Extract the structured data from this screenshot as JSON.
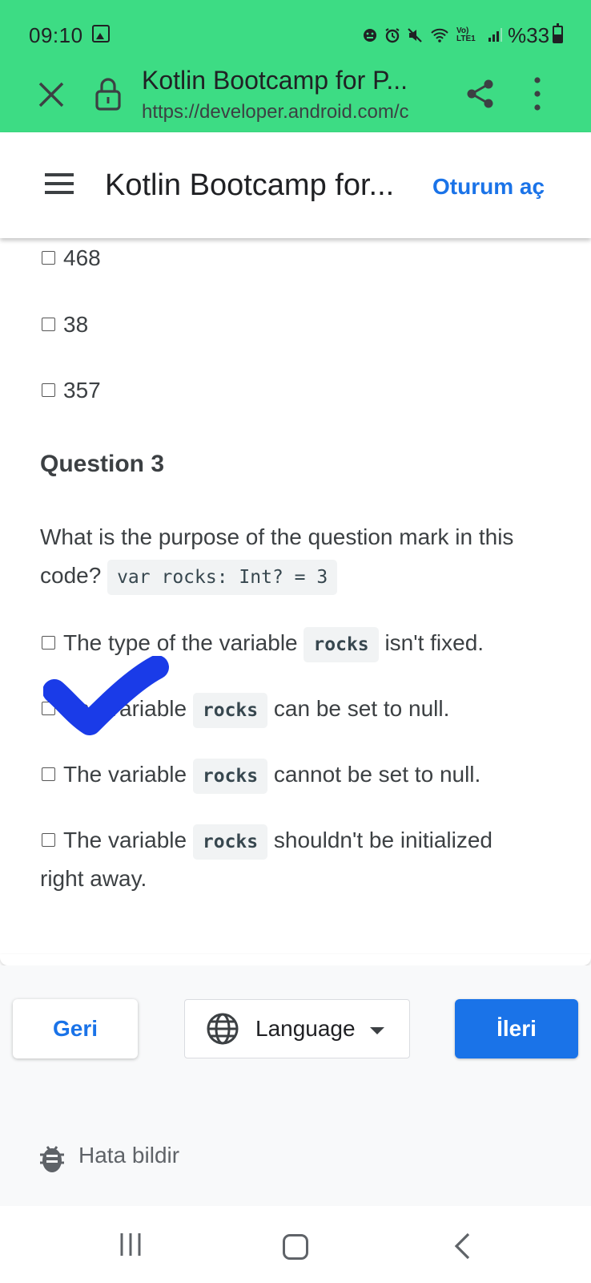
{
  "status_bar": {
    "time": "09:10",
    "network_label": "Vo) LTE1",
    "battery": "%33"
  },
  "tab_bar": {
    "title": "Kotlin Bootcamp for P...",
    "url": "https://developer.android.com/c"
  },
  "page_header": {
    "title": "Kotlin Bootcamp for...",
    "sign_in": "Oturum aç"
  },
  "prev_options": [
    "468",
    "38",
    "357"
  ],
  "question": {
    "heading": "Question 3",
    "text": "What is the purpose of the question mark in this code?",
    "code": "var rocks: Int? = 3",
    "options": [
      {
        "before": "The type of the variable",
        "code": "rocks",
        "after": "isn't fixed.",
        "checked": false
      },
      {
        "before": "The variable",
        "code": "rocks",
        "after": "can be set to null.",
        "checked": true
      },
      {
        "before": "The variable",
        "code": "rocks",
        "after": "cannot be set to null.",
        "checked": false
      },
      {
        "before": "The variable",
        "code": "rocks",
        "after": "shouldn't be initialized",
        "after2": "right away.",
        "checked": false
      }
    ]
  },
  "footer": {
    "back_label": "Geri",
    "language_label": "Language",
    "next_label": "İleri",
    "report_bug": "Hata bildir"
  },
  "colors": {
    "chrome_green": "#3ddc84",
    "link_blue": "#1a73e8",
    "check_mark": "#1a3be8"
  }
}
